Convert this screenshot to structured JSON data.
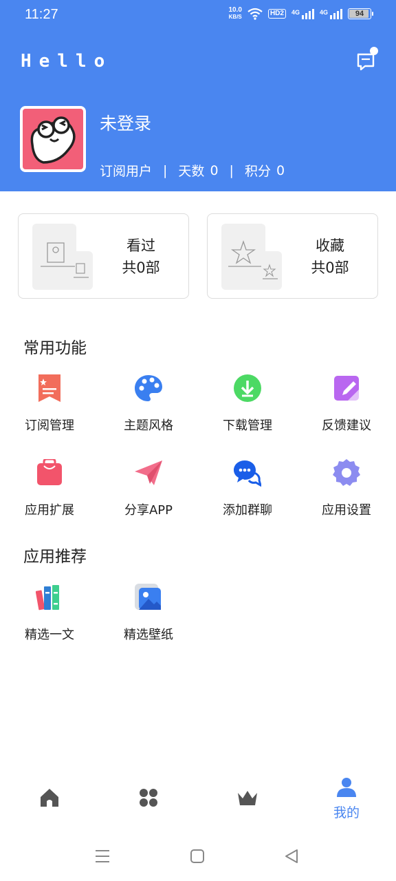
{
  "status_bar": {
    "time": "11:27",
    "net_speed_value": "10.0",
    "net_speed_unit": "KB/S",
    "hd_label": "HD2",
    "sim1_label": "4G",
    "sim2_label": "4G",
    "battery_level": 94,
    "battery_text": "94",
    "icons": [
      "wifi-icon",
      "signal-icon",
      "battery-icon"
    ]
  },
  "header": {
    "title": "Hello",
    "message_icon": "message-icon",
    "background_color": "#4a86f0"
  },
  "user": {
    "name": "未登录",
    "membership": "订阅用户",
    "divider": "|",
    "days_label": "天数",
    "days_value": "0",
    "points_label": "积分",
    "points_value": "0",
    "avatar_color": "#f25f78"
  },
  "cards": [
    {
      "title": "看过",
      "count": "共0部",
      "icon": "history-illustration"
    },
    {
      "title": "收藏",
      "count": "共0部",
      "icon": "favorite-illustration"
    }
  ],
  "common_functions": {
    "title": "常用功能",
    "items": [
      {
        "label": "订阅管理",
        "icon": "subscription-icon",
        "color": "#f26d5b"
      },
      {
        "label": "主题风格",
        "icon": "palette-icon",
        "color": "#3a7ff0"
      },
      {
        "label": "下载管理",
        "icon": "download-icon",
        "color": "#4cd964"
      },
      {
        "label": "反馈建议",
        "icon": "feedback-icon",
        "color": "#b967f0"
      },
      {
        "label": "应用扩展",
        "icon": "shopping-bag-icon",
        "color": "#f2546b"
      },
      {
        "label": "分享APP",
        "icon": "paper-plane-icon",
        "color": "#f26d8a"
      },
      {
        "label": "添加群聊",
        "icon": "chat-bubbles-icon",
        "color": "#1a5ee8"
      },
      {
        "label": "应用设置",
        "icon": "gear-icon",
        "color": "#8c8cf0"
      }
    ]
  },
  "recommended_apps": {
    "title": "应用推荐",
    "items": [
      {
        "label": "精选一文",
        "icon": "books-icon"
      },
      {
        "label": "精选壁纸",
        "icon": "wallpaper-icon"
      }
    ]
  },
  "tabbar": {
    "active_color": "#4a86f0",
    "inactive_color": "#555555",
    "items": [
      {
        "icon": "home-icon",
        "label": ""
      },
      {
        "icon": "apps-icon",
        "label": ""
      },
      {
        "icon": "crown-icon",
        "label": ""
      },
      {
        "icon": "profile-icon",
        "label": "我的"
      }
    ]
  },
  "system_nav": {
    "icons": [
      "menu-icon",
      "home-square-icon",
      "back-icon"
    ]
  }
}
